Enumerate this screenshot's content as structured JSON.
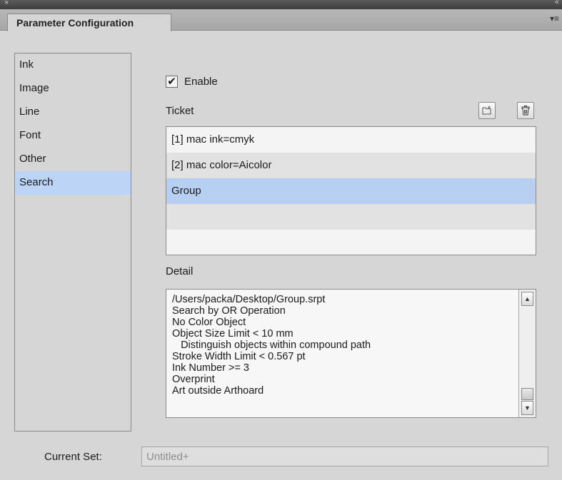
{
  "window": {
    "close_glyph": "×",
    "collapse_glyph": "«",
    "tab_title": "Parameter Configuration",
    "menu_glyph": "▾≡"
  },
  "categories": [
    {
      "label": "Ink",
      "selected": false
    },
    {
      "label": "Image",
      "selected": false
    },
    {
      "label": "Line",
      "selected": false
    },
    {
      "label": "Font",
      "selected": false
    },
    {
      "label": "Other",
      "selected": false
    },
    {
      "label": "Search",
      "selected": true
    }
  ],
  "enable": {
    "label": "Enable",
    "checked": true,
    "check_glyph": "✔"
  },
  "ticket": {
    "label": "Ticket",
    "rows": [
      {
        "text": "[1] mac ink=cmyk",
        "selected": false
      },
      {
        "text": "[2] mac color=Aicolor",
        "selected": false
      },
      {
        "text": "Group",
        "selected": true
      },
      {
        "text": "",
        "selected": false
      },
      {
        "text": "",
        "selected": false
      }
    ],
    "new_icon": "new-ticket-icon",
    "delete_icon": "trash-icon"
  },
  "detail": {
    "label": "Detail",
    "lines": [
      "/Users/packa/Desktop/Group.srpt",
      "Search by OR Operation",
      "No Color Object",
      "Object Size Limit < 10 mm",
      "   Distinguish objects within compound path",
      "Stroke Width Limit < 0.567 pt",
      "Ink Number >= 3",
      "Overprint",
      "Art outside Arthoard"
    ],
    "scroll_up_glyph": "▲",
    "scroll_down_glyph": "▼"
  },
  "current_set": {
    "label": "Current Set:",
    "value": "Untitled+"
  },
  "colors": {
    "panel_bg": "#d6d6d6",
    "selection": "#bcd4f5",
    "titlebar": "#4a4a4a"
  }
}
